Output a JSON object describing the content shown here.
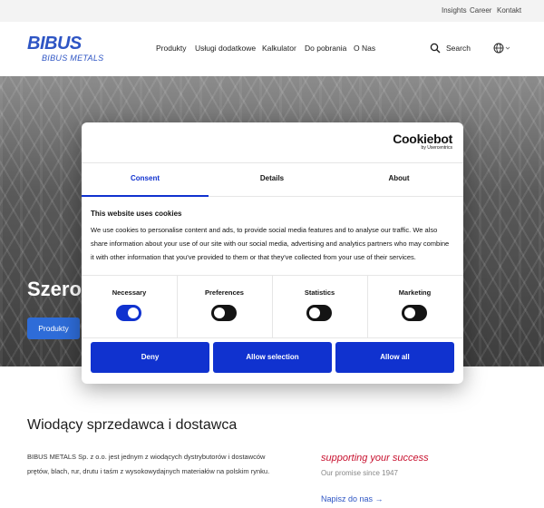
{
  "topbar": {
    "links": [
      "Insights",
      "Career",
      "Kontakt"
    ]
  },
  "header": {
    "logo_main": "BIBUS",
    "logo_sub": "BIBUS METALS",
    "nav": [
      "Produkty",
      "Usługi dodatkowe",
      "Kalkulator",
      "Do pobrania",
      "O Nas"
    ],
    "search_label": "Search",
    "icons": [
      "search-icon",
      "globe-icon",
      "chevron-down-icon"
    ]
  },
  "hero": {
    "title_partial": "Szerok",
    "button_label": "Produkty"
  },
  "cookie_dialog": {
    "brand": "Cookiebot",
    "brand_sub": "by Usercentrics",
    "tabs": [
      "Consent",
      "Details",
      "About"
    ],
    "active_tab": "Consent",
    "heading": "This website uses cookies",
    "body": "We use cookies to personalise content and ads, to provide social media features and to analyse our traffic. We also share information about your use of our site with our social media, advertising and analytics partners who may combine it with other information that you've provided to them or that they've collected from your use of their services.",
    "toggles": [
      {
        "label": "Necessary",
        "on": true
      },
      {
        "label": "Preferences",
        "on": false
      },
      {
        "label": "Statistics",
        "on": false
      },
      {
        "label": "Marketing",
        "on": false
      }
    ],
    "buttons": {
      "deny": "Deny",
      "allow_selection": "Allow selection",
      "allow_all": "Allow all"
    },
    "accent_color": "#1032cf"
  },
  "main": {
    "lead_title": "Wiodący sprzedawca i dostawca",
    "lead_text": "BIBUS METALS Sp. z o.o. jest jednym z wiodących dystrybutorów i dostawców prętów, blach, rur, drutu i taśm z wysokowydajnych materiałów na polskim rynku.",
    "tagline": "supporting your success",
    "promise": "Our promise since 1947",
    "contact_link": "Napisz do nas →"
  },
  "colors": {
    "brand_blue": "#2e55c4",
    "tagline_red": "#c8102e",
    "hero_button": "#2e6cd8"
  }
}
